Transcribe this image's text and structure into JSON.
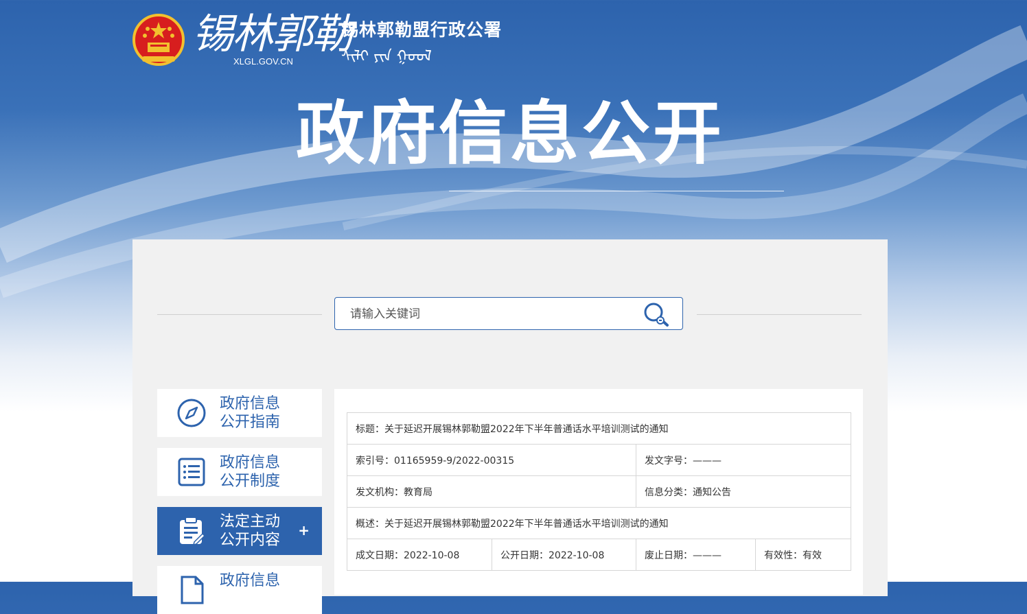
{
  "brand": {
    "script_name": "锡林郭勒",
    "domain": "XLGL.GOV.CN",
    "org_name": "锡林郭勒盟行政公署",
    "mongolian_name": "ᠰᠢᠯᠢ ᠶᠢᠨ ᠭᠣᠣᠯ"
  },
  "hero": {
    "title": "政府信息公开"
  },
  "search": {
    "placeholder": "请输入关键词"
  },
  "nav": [
    {
      "label_line1": "政府信息",
      "label_line2": "公开指南",
      "icon": "compass-icon",
      "active": false
    },
    {
      "label_line1": "政府信息",
      "label_line2": "公开制度",
      "icon": "list-document-icon",
      "active": false
    },
    {
      "label_line1": "法定主动",
      "label_line2": "公开内容",
      "icon": "clipboard-edit-icon",
      "active": true,
      "expand": "+"
    },
    {
      "label_line1": "政府信息",
      "label_line2": "",
      "icon": "document-icon",
      "active": false
    }
  ],
  "meta": {
    "title": "标题：关于延迟开展锡林郭勒盟2022年下半年普通话水平培训测试的通知",
    "index_no": "索引号：01165959-9/2022-00315",
    "doc_no": "发文字号：———",
    "issuer": "发文机构：教育局",
    "category": "信息分类：通知公告",
    "summary": "概述：关于延迟开展锡林郭勒盟2022年下半年普通话水平培训测试的通知",
    "written_date": "成文日期：2022-10-08",
    "publish_date": "公开日期：2022-10-08",
    "expiry_date": "废止日期：———",
    "validity": "有效性：有效"
  },
  "colors": {
    "primary": "#2d63ad",
    "panel": "#f1f1f1",
    "emblem_red": "#d71e1e",
    "emblem_gold": "#f2c12e"
  }
}
